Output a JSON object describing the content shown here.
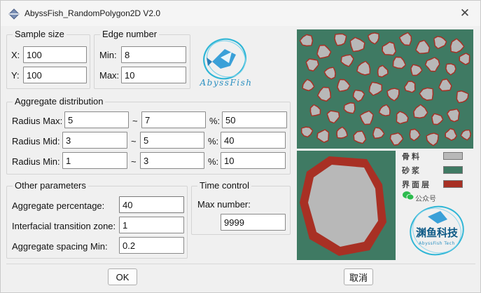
{
  "window": {
    "title": "AbyssFish_RandomPolygon2D V2.0"
  },
  "sample_size": {
    "legend": "Sample size",
    "x_label": "X:",
    "x_value": "100",
    "y_label": "Y:",
    "y_value": "100"
  },
  "edge_number": {
    "legend": "Edge number",
    "min_label": "Min:",
    "min_value": "8",
    "max_label": "Max:",
    "max_value": "10"
  },
  "logo": {
    "text": "AbyssFish"
  },
  "aggregate_distribution": {
    "legend": "Aggregate distribution",
    "tilde": "~",
    "pct_label": "%:",
    "rows": [
      {
        "label": "Radius Max:",
        "from": "5",
        "to": "7",
        "pct": "50"
      },
      {
        "label": "Radius Mid:",
        "from": "3",
        "to": "5",
        "pct": "40"
      },
      {
        "label": "Radius Min:",
        "from": "1",
        "to": "3",
        "pct": "10"
      }
    ]
  },
  "other_parameters": {
    "legend": "Other parameters",
    "aggregate_percentage_label": "Aggregate percentage:",
    "aggregate_percentage_value": "40",
    "itz_label": "Interfacial transition zone:",
    "itz_value": "1",
    "spacing_label": "Aggregate spacing Min:",
    "spacing_value": "0.2"
  },
  "time_control": {
    "legend": "Time control",
    "max_number_label": "Max number:",
    "max_number_value": "9999"
  },
  "legend_panel": {
    "aggregate_label": "骨料",
    "mortar_label": "砂浆",
    "interface_label": "界面层",
    "wechat_label": "公众号",
    "brand_text": "渊鱼科技",
    "brand_sub": "AbyssFish Tech",
    "colors": {
      "aggregate": "#b8b8b8",
      "mortar": "#3f7a63",
      "interface": "#a83024"
    }
  },
  "buttons": {
    "ok": "OK",
    "cancel": "取消"
  }
}
